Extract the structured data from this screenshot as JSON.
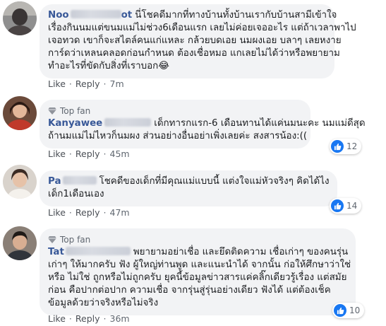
{
  "comments": [
    {
      "name_visible": "Noo",
      "name_tail": "ot",
      "top_fan": false,
      "lines": [
        "นี่โชคดีมากที่ทางบ้านทั้งบ้านเรากับบ้านสามีเข้าใจ",
        "เรื่องกินนมแต่ขนมแม่ไม่ช่วง6เดือนแรก เลยไม่ค่อยเจออะไร แต่ถ้าเวลาพาไป",
        "เจอทวด เขาก็จะสไตล์คนแก่แหละ กล้วยบดเอย นมผงเอย บลาๆ เลยหงาย",
        "การ์ดว่าเหลนคลอดก่อนกำหนด ต้องเชื่อหมอ แกเลยไม่ได้ว่าหรือพยายาม",
        "ทำอะไรที่ขัดกับสิ่งที่เราบอก"
      ],
      "emoji": "😂",
      "like_label": "Like",
      "reply_label": "Reply",
      "time": "7m",
      "reaction_count": ""
    },
    {
      "name_visible": "Kanyawee",
      "top_fan": true,
      "top_fan_label": "Top fan",
      "lines": [
        "เด็กทารกแรก-6 เดือนทานได้แค่นมนะคะ นมแม่ดีสุด",
        "ถ้านมแม่ไม่ไหวก็นมผง ส่วนอย่างอื่นอย่าเพิ่งเลยค่ะ สงสารน้อง:(("
      ],
      "like_label": "Like",
      "reply_label": "Reply",
      "time": "45m",
      "reaction_count": "12"
    },
    {
      "name_visible": "Pa",
      "top_fan": false,
      "lines": [
        "โชคดีของเด็กที่มีคุณแม่แบบนี้ แต่งใจแม่หัวจริงๆ คิดได้ไง",
        "เด็ก1เดือนเอง"
      ],
      "like_label": "Like",
      "reply_label": "Reply",
      "time": "47m",
      "reaction_count": "14"
    },
    {
      "name_visible": "Tat",
      "top_fan": true,
      "top_fan_label": "Top fan",
      "lines": [
        "พยายามอย่าเชื่อ และยึดติดความ เชื่อเก่าๆ ของคนรุ่น",
        "เก่าๆ ให้มากครับ ฟัง ผู้ใหญ่ท่านพูด และแนะนำได้ จากนั้น ก่อให้ศึกษาว่าใช่",
        "หรือ ไม่ใช่ ถูกหรือไม่ถูกครับ ยุคนี้ข้อมูลข่าวสารแค่คลิ๊กเดียวรู้เรื่อง แต่สมัย",
        "ก่อน คือปากต่อปาก ความเชื่อ จากรุ่นสู่รุ่นอย่างเดียว ฟังได้ แต่ต้องเช็ค",
        "ข้อมูลด้วยว่าจริงหรือไม่จริง"
      ],
      "like_label": "Like",
      "reply_label": "Reply",
      "time": "36m",
      "reaction_count": "10"
    }
  ],
  "colors": {
    "name": "#385898",
    "bubble": "#f2f3f5",
    "like_blue": "#1877f2",
    "text": "#1c1e21",
    "meta": "#606770"
  },
  "icons": {
    "top_fan": "diamond-badge-icon",
    "reaction": "thumbs-up-icon"
  }
}
